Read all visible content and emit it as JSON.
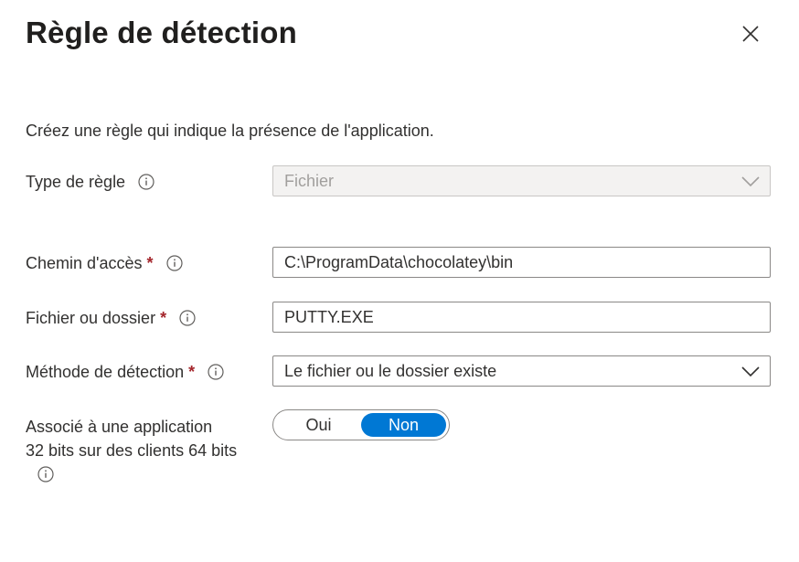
{
  "panel": {
    "title": "Règle de détection",
    "close_icon": "close-icon"
  },
  "intro": "Créez une règle qui indique la présence de l'application.",
  "fields": {
    "rule_type": {
      "label": "Type de règle",
      "value": "Fichier",
      "disabled": true
    },
    "path": {
      "label": "Chemin d'accès",
      "required_mark": "*",
      "value": "C:\\ProgramData\\chocolatey\\bin"
    },
    "file_or_folder": {
      "label": "Fichier ou dossier",
      "required_mark": "*",
      "value": "PUTTY.EXE"
    },
    "detection_method": {
      "label": "Méthode de détection",
      "required_mark": "*",
      "value": "Le fichier ou le dossier existe"
    },
    "associated_32bit": {
      "label_line1": "Associé à une application",
      "label_line2": "32 bits sur des clients 64 bits",
      "options": [
        "Oui",
        "Non"
      ],
      "selected": "Non"
    }
  },
  "colors": {
    "accent": "#0078d4",
    "required": "#a4262c",
    "border": "#8a8886",
    "disabled_bg": "#f3f2f1"
  }
}
